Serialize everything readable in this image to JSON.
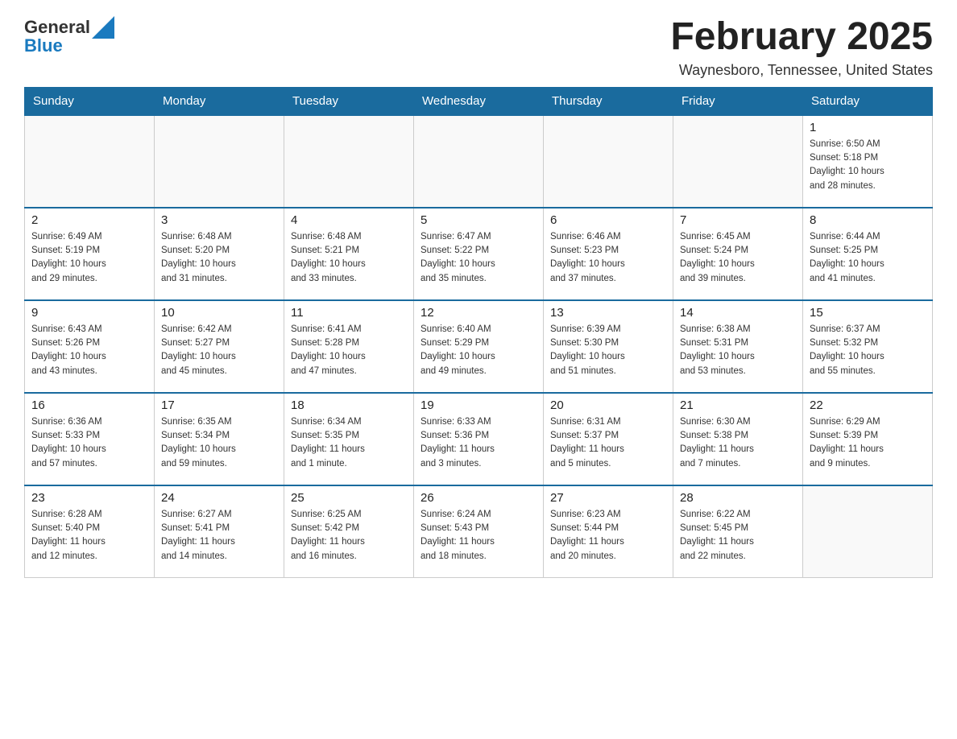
{
  "header": {
    "logo_general": "General",
    "logo_blue": "Blue",
    "month_title": "February 2025",
    "location": "Waynesboro, Tennessee, United States"
  },
  "days_of_week": [
    "Sunday",
    "Monday",
    "Tuesday",
    "Wednesday",
    "Thursday",
    "Friday",
    "Saturday"
  ],
  "weeks": [
    [
      {
        "day": "",
        "info": ""
      },
      {
        "day": "",
        "info": ""
      },
      {
        "day": "",
        "info": ""
      },
      {
        "day": "",
        "info": ""
      },
      {
        "day": "",
        "info": ""
      },
      {
        "day": "",
        "info": ""
      },
      {
        "day": "1",
        "info": "Sunrise: 6:50 AM\nSunset: 5:18 PM\nDaylight: 10 hours\nand 28 minutes."
      }
    ],
    [
      {
        "day": "2",
        "info": "Sunrise: 6:49 AM\nSunset: 5:19 PM\nDaylight: 10 hours\nand 29 minutes."
      },
      {
        "day": "3",
        "info": "Sunrise: 6:48 AM\nSunset: 5:20 PM\nDaylight: 10 hours\nand 31 minutes."
      },
      {
        "day": "4",
        "info": "Sunrise: 6:48 AM\nSunset: 5:21 PM\nDaylight: 10 hours\nand 33 minutes."
      },
      {
        "day": "5",
        "info": "Sunrise: 6:47 AM\nSunset: 5:22 PM\nDaylight: 10 hours\nand 35 minutes."
      },
      {
        "day": "6",
        "info": "Sunrise: 6:46 AM\nSunset: 5:23 PM\nDaylight: 10 hours\nand 37 minutes."
      },
      {
        "day": "7",
        "info": "Sunrise: 6:45 AM\nSunset: 5:24 PM\nDaylight: 10 hours\nand 39 minutes."
      },
      {
        "day": "8",
        "info": "Sunrise: 6:44 AM\nSunset: 5:25 PM\nDaylight: 10 hours\nand 41 minutes."
      }
    ],
    [
      {
        "day": "9",
        "info": "Sunrise: 6:43 AM\nSunset: 5:26 PM\nDaylight: 10 hours\nand 43 minutes."
      },
      {
        "day": "10",
        "info": "Sunrise: 6:42 AM\nSunset: 5:27 PM\nDaylight: 10 hours\nand 45 minutes."
      },
      {
        "day": "11",
        "info": "Sunrise: 6:41 AM\nSunset: 5:28 PM\nDaylight: 10 hours\nand 47 minutes."
      },
      {
        "day": "12",
        "info": "Sunrise: 6:40 AM\nSunset: 5:29 PM\nDaylight: 10 hours\nand 49 minutes."
      },
      {
        "day": "13",
        "info": "Sunrise: 6:39 AM\nSunset: 5:30 PM\nDaylight: 10 hours\nand 51 minutes."
      },
      {
        "day": "14",
        "info": "Sunrise: 6:38 AM\nSunset: 5:31 PM\nDaylight: 10 hours\nand 53 minutes."
      },
      {
        "day": "15",
        "info": "Sunrise: 6:37 AM\nSunset: 5:32 PM\nDaylight: 10 hours\nand 55 minutes."
      }
    ],
    [
      {
        "day": "16",
        "info": "Sunrise: 6:36 AM\nSunset: 5:33 PM\nDaylight: 10 hours\nand 57 minutes."
      },
      {
        "day": "17",
        "info": "Sunrise: 6:35 AM\nSunset: 5:34 PM\nDaylight: 10 hours\nand 59 minutes."
      },
      {
        "day": "18",
        "info": "Sunrise: 6:34 AM\nSunset: 5:35 PM\nDaylight: 11 hours\nand 1 minute."
      },
      {
        "day": "19",
        "info": "Sunrise: 6:33 AM\nSunset: 5:36 PM\nDaylight: 11 hours\nand 3 minutes."
      },
      {
        "day": "20",
        "info": "Sunrise: 6:31 AM\nSunset: 5:37 PM\nDaylight: 11 hours\nand 5 minutes."
      },
      {
        "day": "21",
        "info": "Sunrise: 6:30 AM\nSunset: 5:38 PM\nDaylight: 11 hours\nand 7 minutes."
      },
      {
        "day": "22",
        "info": "Sunrise: 6:29 AM\nSunset: 5:39 PM\nDaylight: 11 hours\nand 9 minutes."
      }
    ],
    [
      {
        "day": "23",
        "info": "Sunrise: 6:28 AM\nSunset: 5:40 PM\nDaylight: 11 hours\nand 12 minutes."
      },
      {
        "day": "24",
        "info": "Sunrise: 6:27 AM\nSunset: 5:41 PM\nDaylight: 11 hours\nand 14 minutes."
      },
      {
        "day": "25",
        "info": "Sunrise: 6:25 AM\nSunset: 5:42 PM\nDaylight: 11 hours\nand 16 minutes."
      },
      {
        "day": "26",
        "info": "Sunrise: 6:24 AM\nSunset: 5:43 PM\nDaylight: 11 hours\nand 18 minutes."
      },
      {
        "day": "27",
        "info": "Sunrise: 6:23 AM\nSunset: 5:44 PM\nDaylight: 11 hours\nand 20 minutes."
      },
      {
        "day": "28",
        "info": "Sunrise: 6:22 AM\nSunset: 5:45 PM\nDaylight: 11 hours\nand 22 minutes."
      },
      {
        "day": "",
        "info": ""
      }
    ]
  ]
}
